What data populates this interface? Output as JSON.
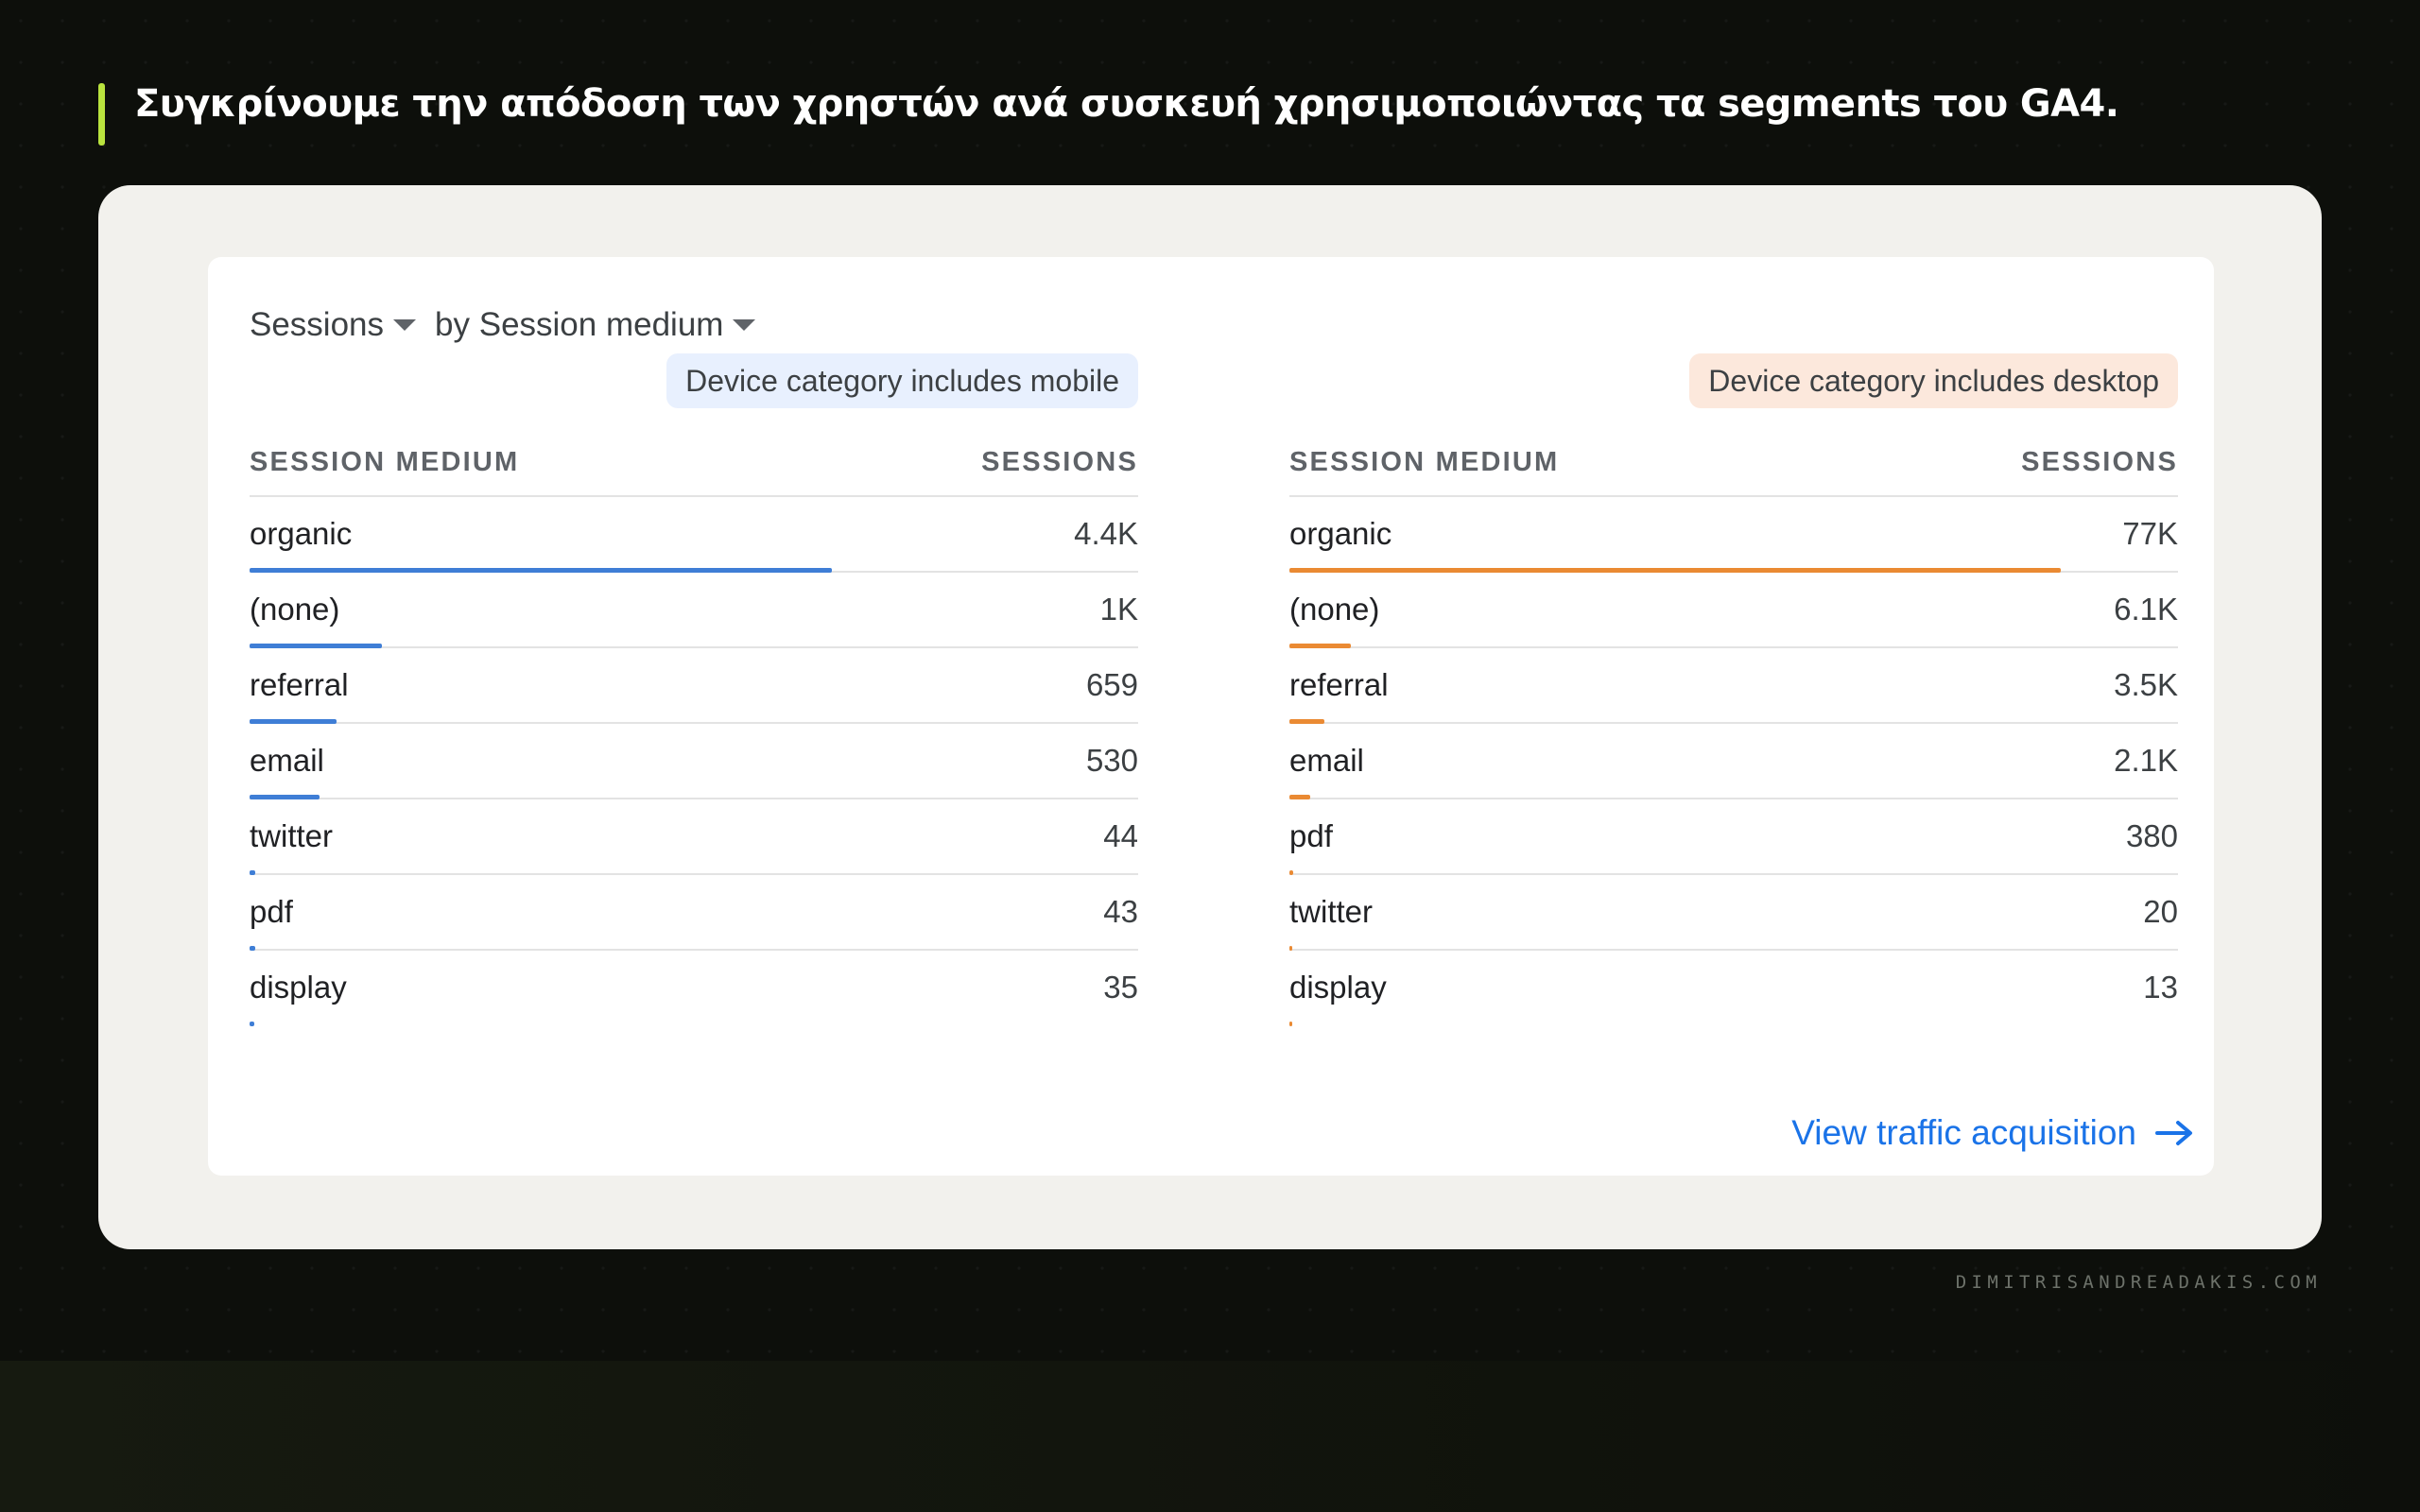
{
  "headline": "Συγκρίνουμε την απόδοση των χρηστών ανά συσκευή χρησιμοποιώντας τα segments του GA4.",
  "card": {
    "metric_label": "Sessions",
    "dimension_label": "by Session medium",
    "view_link": "View traffic acquisition",
    "panels": [
      {
        "segment": "Device category includes mobile",
        "col_dimension": "SESSION MEDIUM",
        "col_metric": "SESSIONS",
        "rows": [
          {
            "label": "organic",
            "value": "4.4K"
          },
          {
            "label": "(none)",
            "value": "1K"
          },
          {
            "label": "referral",
            "value": "659"
          },
          {
            "label": "email",
            "value": "530"
          },
          {
            "label": "twitter",
            "value": "44"
          },
          {
            "label": "pdf",
            "value": "43"
          },
          {
            "label": "display",
            "value": "35"
          }
        ]
      },
      {
        "segment": "Device category includes desktop",
        "col_dimension": "SESSION MEDIUM",
        "col_metric": "SESSIONS",
        "rows": [
          {
            "label": "organic",
            "value": "77K"
          },
          {
            "label": "(none)",
            "value": "6.1K"
          },
          {
            "label": "referral",
            "value": "3.5K"
          },
          {
            "label": "email",
            "value": "2.1K"
          },
          {
            "label": "pdf",
            "value": "380"
          },
          {
            "label": "twitter",
            "value": "20"
          },
          {
            "label": "display",
            "value": "13"
          }
        ]
      }
    ]
  },
  "credit": "DIMITRISANDREADAKIS.COM",
  "colors": {
    "accent": "#b9e33e",
    "mobile_series": "#3f7ed6",
    "desktop_series": "#ea8a33",
    "link": "#1a73e8"
  }
}
